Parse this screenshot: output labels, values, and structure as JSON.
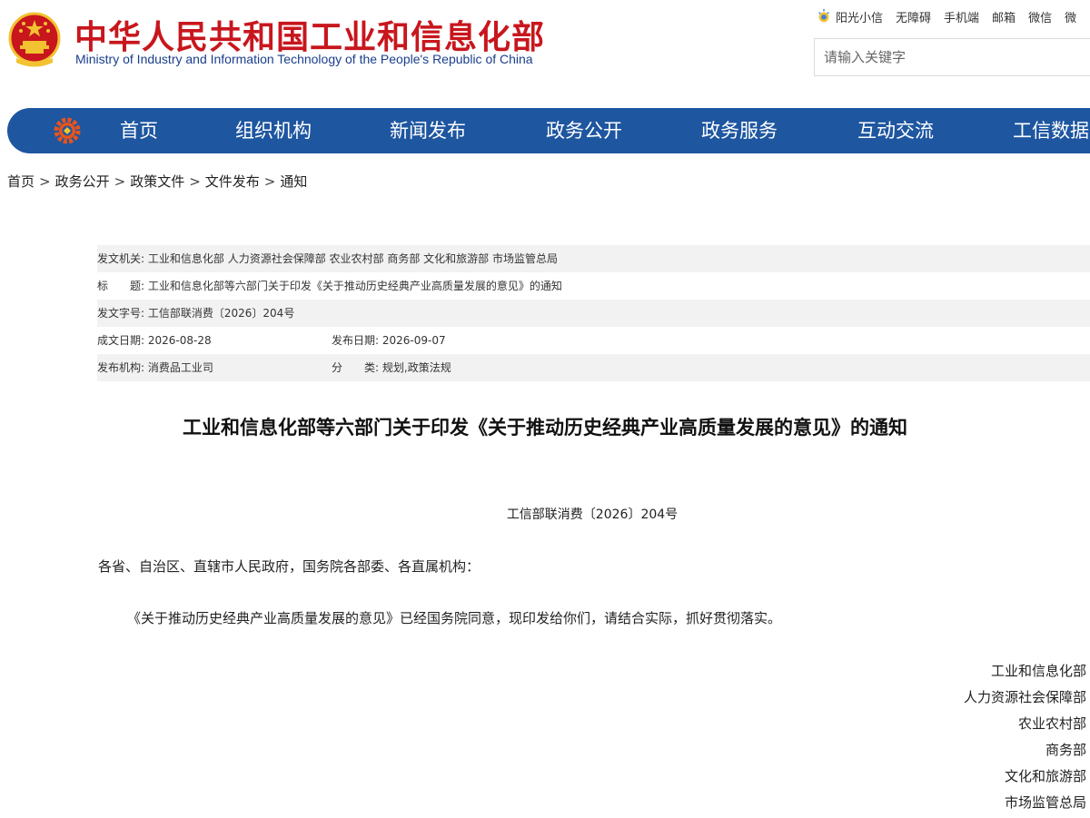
{
  "header": {
    "site_title": "中华人民共和国工业和信息化部",
    "site_subtitle": "Ministry of Industry and Information Technology of the People's Republic of China",
    "top_links": [
      "阳光小信",
      "无障碍",
      "手机端",
      "邮箱",
      "微信",
      "微"
    ],
    "search_placeholder": "请输入关键字"
  },
  "nav": {
    "items": [
      "首页",
      "组织机构",
      "新闻发布",
      "政务公开",
      "政务服务",
      "互动交流",
      "工信数据"
    ]
  },
  "breadcrumb": [
    "首页",
    "政务公开",
    "政策文件",
    "文件发布",
    "通知"
  ],
  "meta": {
    "issuer_label": "发文机关:",
    "issuer_value": "工业和信息化部 人力资源社会保障部 农业农村部 商务部 文化和旅游部 市场监管总局",
    "title_label": "标　　题:",
    "title_value": "工业和信息化部等六部门关于印发《关于推动历史经典产业高质量发展的意见》的通知",
    "docno_label": "发文字号:",
    "docno_value": "工信部联消费〔2026〕204号",
    "created_label": "成文日期:",
    "created_value": "2026-08-28",
    "published_label": "发布日期:",
    "published_value": "2026-09-07",
    "org_label": "发布机构:",
    "org_value": "消费品工业司",
    "category_label": "分　　类:",
    "category_value": "规划,政策法规"
  },
  "document": {
    "title": "工业和信息化部等六部门关于印发《关于推动历史经典产业高质量发展的意见》的通知",
    "number": "工信部联消费〔2026〕204号",
    "addressee": "各省、自治区、直辖市人民政府，国务院各部委、各直属机构：",
    "body": "《关于推动历史经典产业高质量发展的意见》已经国务院同意，现印发给你们，请结合实际，抓好贯彻落实。",
    "signatories": [
      "工业和信息化部",
      "人力资源社会保障部",
      "农业农村部",
      "商务部",
      "文化和旅游部",
      "市场监管总局"
    ]
  },
  "colors": {
    "brand_red": "#c8161d",
    "brand_blue": "#1e56a0",
    "emblem_gold": "#f2c230",
    "meta_shade": "#f2f2f2"
  }
}
